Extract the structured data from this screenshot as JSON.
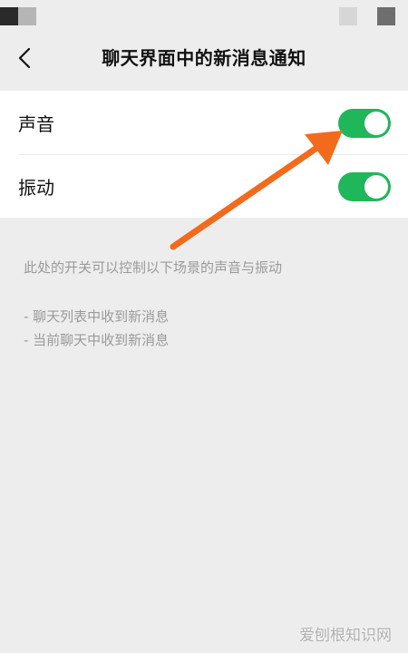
{
  "nav": {
    "title": "聊天界面中的新消息通知",
    "back_icon": "chevron-left-icon"
  },
  "settings": {
    "rows": [
      {
        "label": "声音",
        "enabled": true
      },
      {
        "label": "振动",
        "enabled": true
      }
    ],
    "toggle_on_color": "#20b65a"
  },
  "hint": {
    "description": "此处的开关可以控制以下场景的声音与振动",
    "scenes": [
      "- 聊天列表中收到新消息",
      "- 当前聊天中收到新消息"
    ]
  },
  "annotation": {
    "arrow_color": "#f26b1d"
  },
  "watermark": {
    "text": "爱刨根知识网"
  }
}
